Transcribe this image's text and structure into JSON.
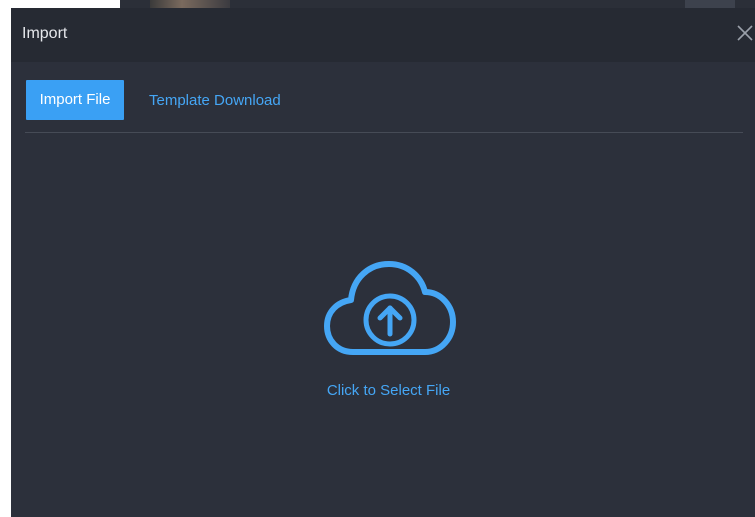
{
  "dialog": {
    "title": "Import",
    "close_icon": "close-icon"
  },
  "tabs": {
    "active_label": "Import File",
    "link_label": "Template Download"
  },
  "upload": {
    "icon": "cloud-upload-icon",
    "label": "Click to Select File"
  },
  "colors": {
    "accent": "#3aa0f4",
    "link": "#45a6f5",
    "dialog_bg": "#2c303b",
    "header_bg": "#262a33"
  }
}
